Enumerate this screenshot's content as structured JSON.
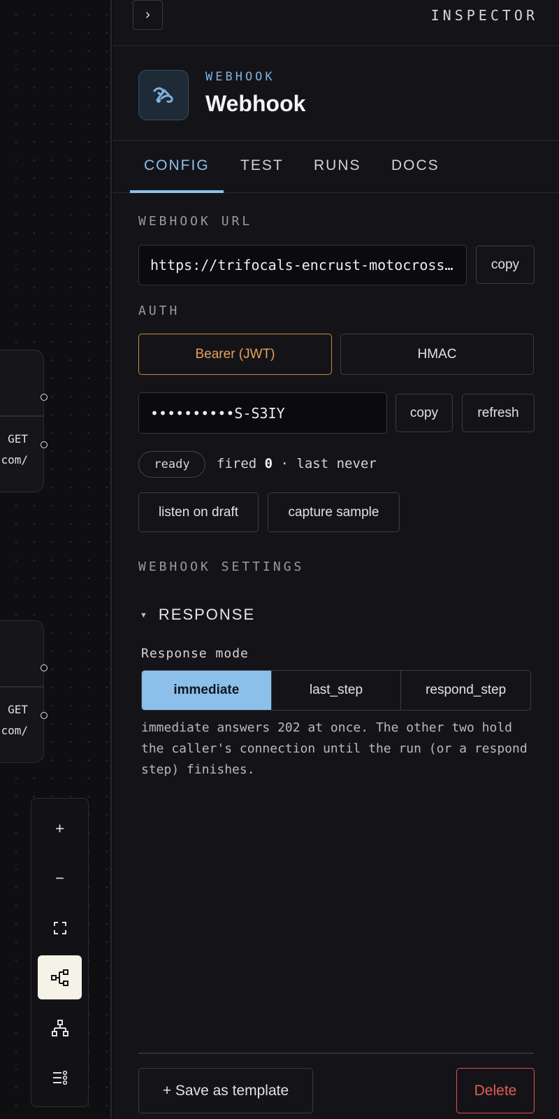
{
  "canvas": {
    "nodes": [
      {
        "line1": "GET",
        "line2": "com/"
      },
      {
        "line1": "GET",
        "line2": "com/"
      }
    ],
    "toolbar": {
      "zoom_in": "+",
      "zoom_out": "−",
      "tools": [
        "zoom-in-icon",
        "zoom-out-icon",
        "fit-view-icon",
        "flow-layout-icon",
        "tree-layout-icon",
        "list-layout-icon"
      ],
      "active_tool": "flow-layout-icon"
    }
  },
  "inspector": {
    "title": "INSPECTOR",
    "collapse_glyph": "›",
    "node": {
      "kind": "WEBHOOK",
      "name": "Webhook",
      "icon": "webhook-icon",
      "accent": "#7fb3e0"
    },
    "tabs": [
      {
        "label": "CONFIG",
        "active": true
      },
      {
        "label": "TEST",
        "active": false
      },
      {
        "label": "RUNS",
        "active": false
      },
      {
        "label": "DOCS",
        "active": false
      }
    ],
    "webhook_url": {
      "label": "WEBHOOK URL",
      "value": "https://trifocals-encrust-motocross.example.com/",
      "copy_label": "copy"
    },
    "auth": {
      "label": "AUTH",
      "options": [
        "Bearer (JWT)",
        "HMAC"
      ],
      "selected": "Bearer (JWT)",
      "token_value": "••••••••••S-S3IY",
      "copy_label": "copy",
      "refresh_label": "refresh"
    },
    "status": {
      "pill": "ready",
      "fired_prefix": "fired ",
      "fired_count": "0",
      "last_suffix": " · last never"
    },
    "actions": {
      "listen_label": "listen on draft",
      "capture_label": "capture sample"
    },
    "settings": {
      "label": "WEBHOOK SETTINGS",
      "section_title": "RESPONSE",
      "response_mode_label": "Response mode",
      "modes": [
        "immediate",
        "last_step",
        "respond_step"
      ],
      "selected_mode": "immediate",
      "help": "immediate answers 202 at once. The other two hold the caller's connection until the run (or a respond step) finishes."
    },
    "footer": {
      "save_label": "+ Save as template",
      "delete_label": "Delete",
      "delete_color": "#e25c58"
    }
  }
}
